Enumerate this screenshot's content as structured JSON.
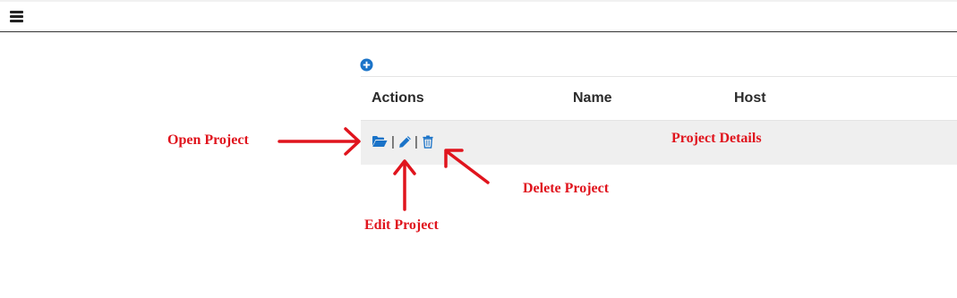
{
  "header": {
    "menu_icon": "hamburger-icon"
  },
  "toolbar": {
    "add_icon": "plus-circle-icon"
  },
  "table": {
    "columns": [
      "Actions",
      "Name",
      "Host"
    ],
    "row_actions": {
      "open_icon": "folder-open-icon",
      "edit_icon": "pencil-icon",
      "delete_icon": "trash-icon",
      "separator": "|"
    }
  },
  "annotations": {
    "open": "Open Project",
    "edit": "Edit Project",
    "delete": "Delete Project",
    "details": "Project Details"
  },
  "colors": {
    "accent": "#1a73c8",
    "annotation": "#e0141d",
    "row_bg": "#efefef"
  }
}
